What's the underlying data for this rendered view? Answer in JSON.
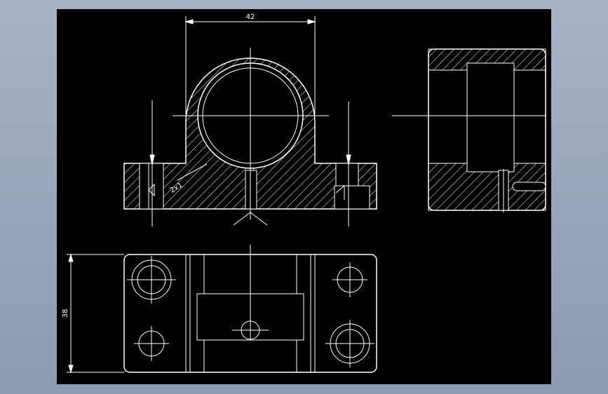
{
  "drawing": {
    "dimensions": {
      "width_top": "42",
      "height_left": "38",
      "chamfer": "2x1"
    },
    "colors": {
      "background": "#000000",
      "lines": "#ffffff",
      "canvas_frame": "#a7b2c5"
    }
  }
}
